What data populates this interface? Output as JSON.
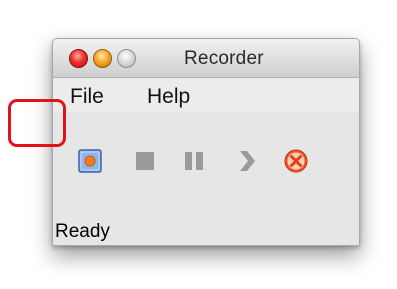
{
  "window": {
    "title": "Recorder"
  },
  "menubar": {
    "items": [
      {
        "label": "File"
      },
      {
        "label": "Help"
      }
    ]
  },
  "toolbar": {
    "buttons": [
      {
        "icon": "record-icon",
        "state": "highlighted"
      },
      {
        "icon": "stop-icon",
        "state": "disabled"
      },
      {
        "icon": "pause-icon",
        "state": "disabled"
      },
      {
        "icon": "play-icon",
        "state": "disabled"
      },
      {
        "icon": "cancel-icon",
        "state": "enabled"
      }
    ]
  },
  "status": {
    "text": "Ready"
  },
  "colors": {
    "highlight": "#e0121c",
    "record_fill": "#8fb4e8",
    "record_dot": "#f07d1a",
    "disabled_icon": "#9a9a9a",
    "cancel": "#f05a2a"
  }
}
